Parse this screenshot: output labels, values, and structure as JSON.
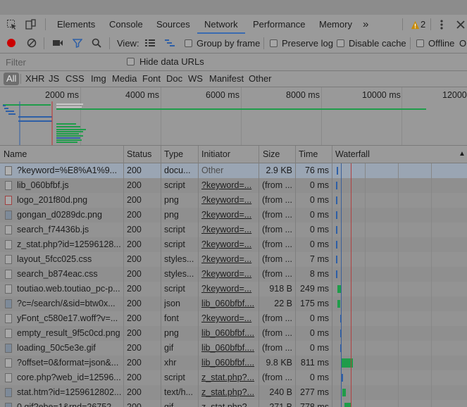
{
  "tabs": [
    {
      "label": "Elements"
    },
    {
      "label": "Console"
    },
    {
      "label": "Sources"
    },
    {
      "label": "Network",
      "active": true
    },
    {
      "label": "Performance"
    },
    {
      "label": "Memory"
    }
  ],
  "overflow_label": "»",
  "warnings": {
    "count": "2",
    "color": "#c98a00"
  },
  "toolbar": {
    "view_label": "View:",
    "group_by_frame": "Group by frame",
    "preserve_log": "Preserve log",
    "disable_cache": "Disable cache",
    "offline": "Offline",
    "online_partial": "Or",
    "record_color": "#cc0000"
  },
  "filter": {
    "placeholder": "Filter",
    "hide_data_urls": "Hide data URLs"
  },
  "types": [
    "All",
    "XHR",
    "JS",
    "CSS",
    "Img",
    "Media",
    "Font",
    "Doc",
    "WS",
    "Manifest",
    "Other"
  ],
  "overview": {
    "ticks": [
      "2000 ms",
      "4000 ms",
      "6000 ms",
      "8000 ms",
      "10000 ms",
      "12000"
    ]
  },
  "columns": {
    "name": "Name",
    "status": "Status",
    "type": "Type",
    "initiator": "Initiator",
    "size": "Size",
    "time": "Time",
    "waterfall": "Waterfall"
  },
  "rows": [
    {
      "name": "?keyword=%E8%A1%9...",
      "status": "200",
      "type": "docu...",
      "initiator": "Other",
      "size": "2.9 KB",
      "time": "76 ms",
      "icon": "document-icon"
    },
    {
      "name": "lib_060bfbf.js",
      "status": "200",
      "type": "script",
      "initiator": "?keyword=...",
      "size": "(from ...",
      "time": "0 ms",
      "icon": "script-file-icon"
    },
    {
      "name": "logo_201f80d.png",
      "status": "200",
      "type": "png",
      "initiator": "?keyword=...",
      "size": "(from ...",
      "time": "0 ms",
      "icon": "image-file-icon"
    },
    {
      "name": "gongan_d0289dc.png",
      "status": "200",
      "type": "png",
      "initiator": "?keyword=...",
      "size": "(from ...",
      "time": "0 ms",
      "icon": "image-thumbnail-icon"
    },
    {
      "name": "search_f74436b.js",
      "status": "200",
      "type": "script",
      "initiator": "?keyword=...",
      "size": "(from ...",
      "time": "0 ms",
      "icon": "script-file-icon"
    },
    {
      "name": "z_stat.php?id=12596128...",
      "status": "200",
      "type": "script",
      "initiator": "?keyword=...",
      "size": "(from ...",
      "time": "0 ms",
      "icon": "script-file-icon"
    },
    {
      "name": "layout_5fcc025.css",
      "status": "200",
      "type": "styles...",
      "initiator": "?keyword=...",
      "size": "(from ...",
      "time": "7 ms",
      "icon": "stylesheet-file-icon"
    },
    {
      "name": "search_b874eac.css",
      "status": "200",
      "type": "styles...",
      "initiator": "?keyword=...",
      "size": "(from ...",
      "time": "8 ms",
      "icon": "stylesheet-file-icon"
    },
    {
      "name": "toutiao.web.toutiao_pc-p...",
      "status": "200",
      "type": "script",
      "initiator": "?keyword=...",
      "size": "918 B",
      "time": "249 ms",
      "icon": "script-file-icon"
    },
    {
      "name": "?c=/search/&sid=btw0x...",
      "status": "200",
      "type": "json",
      "initiator": "lib_060bfbf....",
      "size": "22 B",
      "time": "175 ms",
      "icon": "image-thumbnail-icon"
    },
    {
      "name": "yFont_c580e17.woff?v=...",
      "status": "200",
      "type": "font",
      "initiator": "?keyword=...",
      "size": "(from ...",
      "time": "0 ms",
      "icon": "font-file-icon"
    },
    {
      "name": "empty_result_9f5c0cd.png",
      "status": "200",
      "type": "png",
      "initiator": "lib_060bfbf....",
      "size": "(from ...",
      "time": "0 ms",
      "icon": "image-file-icon"
    },
    {
      "name": "loading_50c5e3e.gif",
      "status": "200",
      "type": "gif",
      "initiator": "lib_060bfbf....",
      "size": "(from ...",
      "time": "0 ms",
      "icon": "image-thumbnail-icon"
    },
    {
      "name": "?offset=0&format=json&...",
      "status": "200",
      "type": "xhr",
      "initiator": "lib_060bfbf....",
      "size": "9.8 KB",
      "time": "811 ms",
      "icon": "xhr-file-icon"
    },
    {
      "name": "core.php?web_id=12596...",
      "status": "200",
      "type": "script",
      "initiator": "z_stat.php?...",
      "size": "(from ...",
      "time": "0 ms",
      "icon": "script-file-icon"
    },
    {
      "name": "stat.htm?id=1259612802...",
      "status": "200",
      "type": "text/h...",
      "initiator": "z_stat.php?...",
      "size": "240 B",
      "time": "277 ms",
      "icon": "image-thumbnail-icon"
    },
    {
      "name": "0.gif?ebe=1&rnd=26752...",
      "status": "200",
      "type": "gif",
      "initiator": "z_stat.php?...",
      "size": "271 B",
      "time": "778 ms",
      "icon": "image-thumbnail-icon"
    }
  ]
}
